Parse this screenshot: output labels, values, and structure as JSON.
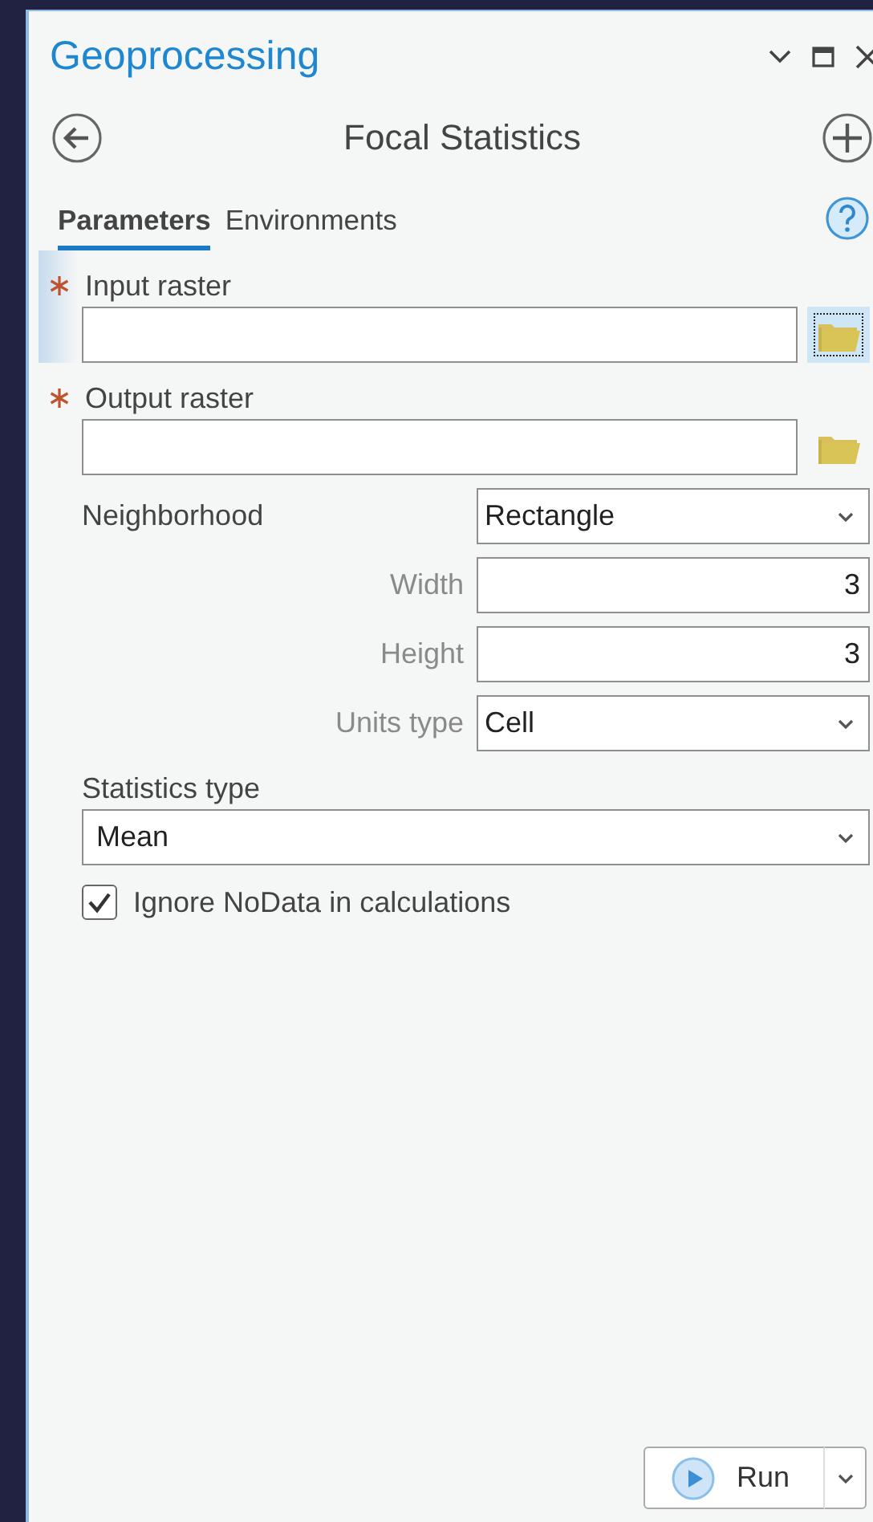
{
  "window": {
    "title": "Geoprocessing"
  },
  "tool": {
    "title": "Focal Statistics"
  },
  "tabs": [
    {
      "label": "Parameters",
      "selected": true
    },
    {
      "label": "Environments",
      "selected": false
    }
  ],
  "parameters": [
    {
      "kind": "dataset",
      "label": "Input raster",
      "required": true,
      "focused": true
    },
    {
      "kind": "dataset",
      "label": "Output raster",
      "required": true,
      "focused": false
    },
    {
      "kind": "inline-dropdown",
      "label": "Neighborhood",
      "value": "Rectangle"
    },
    {
      "kind": "sub-number",
      "label": "Width",
      "value": "3"
    },
    {
      "kind": "sub-number",
      "label": "Height",
      "value": "3"
    },
    {
      "kind": "sub-dropdown",
      "label": "Units type",
      "value": "Cell"
    },
    {
      "kind": "dropdown",
      "label": "Statistics type",
      "value": "Mean"
    },
    {
      "kind": "checkbox",
      "label": "Ignore NoData in calculations",
      "checked": true
    }
  ],
  "run_button": {
    "label": "Run"
  }
}
